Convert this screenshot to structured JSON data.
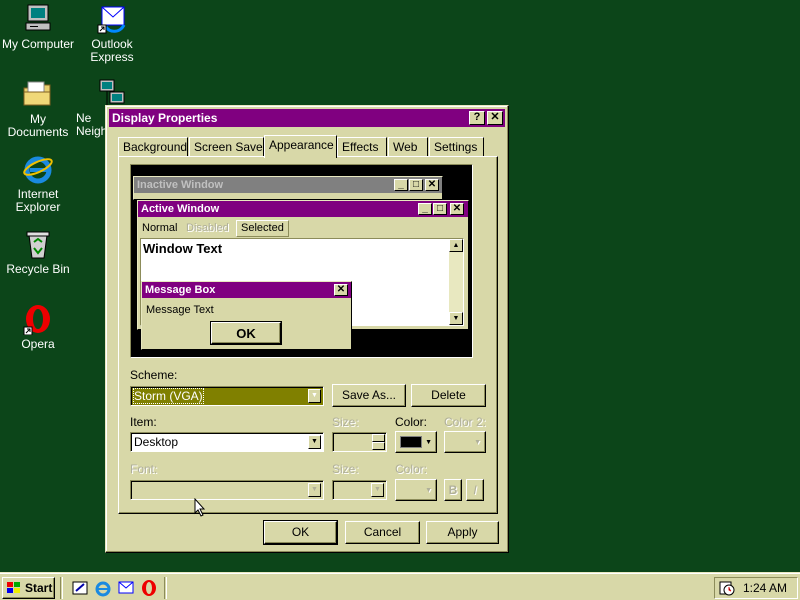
{
  "desktop": {
    "icons": [
      {
        "label": "My Computer",
        "icon": "computer-icon"
      },
      {
        "label": "Outlook Express",
        "icon": "outlook-express-icon"
      },
      {
        "label": "My Documents",
        "icon": "folder-icon"
      },
      {
        "label": "Network Neighborhood",
        "visible_label": "Ne Neigh",
        "icon": "network-icon"
      },
      {
        "label": "Internet Explorer",
        "icon": "internet-explorer-icon"
      },
      {
        "label": "Recycle Bin",
        "icon": "recycle-bin-icon"
      },
      {
        "label": "Opera",
        "icon": "opera-icon"
      }
    ]
  },
  "window": {
    "title": "Display Properties",
    "help_glyph": "?",
    "close_glyph": "✕",
    "tabs": [
      {
        "label": "Background"
      },
      {
        "label": "Screen Saver"
      },
      {
        "label": "Appearance"
      },
      {
        "label": "Effects"
      },
      {
        "label": "Web"
      },
      {
        "label": "Settings"
      }
    ],
    "active_tab": "Appearance",
    "preview": {
      "inactive_title": "Inactive Window",
      "active_title": "Active Window",
      "menu": {
        "normal": "Normal",
        "disabled": "Disabled",
        "selected": "Selected"
      },
      "window_text": "Window Text",
      "msgbox_title": "Message Box",
      "msgbox_text": "Message Text",
      "msgbox_ok": "OK"
    },
    "scheme": {
      "label": "Scheme:",
      "value": "Storm (VGA)",
      "save_as": "Save As...",
      "delete": "Delete"
    },
    "item": {
      "label": "Item:",
      "value": "Desktop",
      "size_label": "Size:",
      "color_label": "Color:",
      "color2_label": "Color 2:",
      "color_value": "#000000"
    },
    "font": {
      "label": "Font:",
      "value": "",
      "size_label": "Size:",
      "color_label": "Color:",
      "bold": "B",
      "italic": "I"
    },
    "buttons": {
      "ok": "OK",
      "cancel": "Cancel",
      "apply": "Apply"
    }
  },
  "taskbar": {
    "start_label": "Start",
    "quick_launch": [
      "show-desktop-icon",
      "internet-explorer-icon",
      "outlook-express-icon",
      "opera-icon"
    ],
    "clock": "1:24 AM"
  },
  "colors": {
    "desktop": "#0c4519",
    "face": "#d8d8a8",
    "titlebar": "#800080",
    "inactive_titlebar": "#808080",
    "scheme_highlight": "#808000"
  }
}
